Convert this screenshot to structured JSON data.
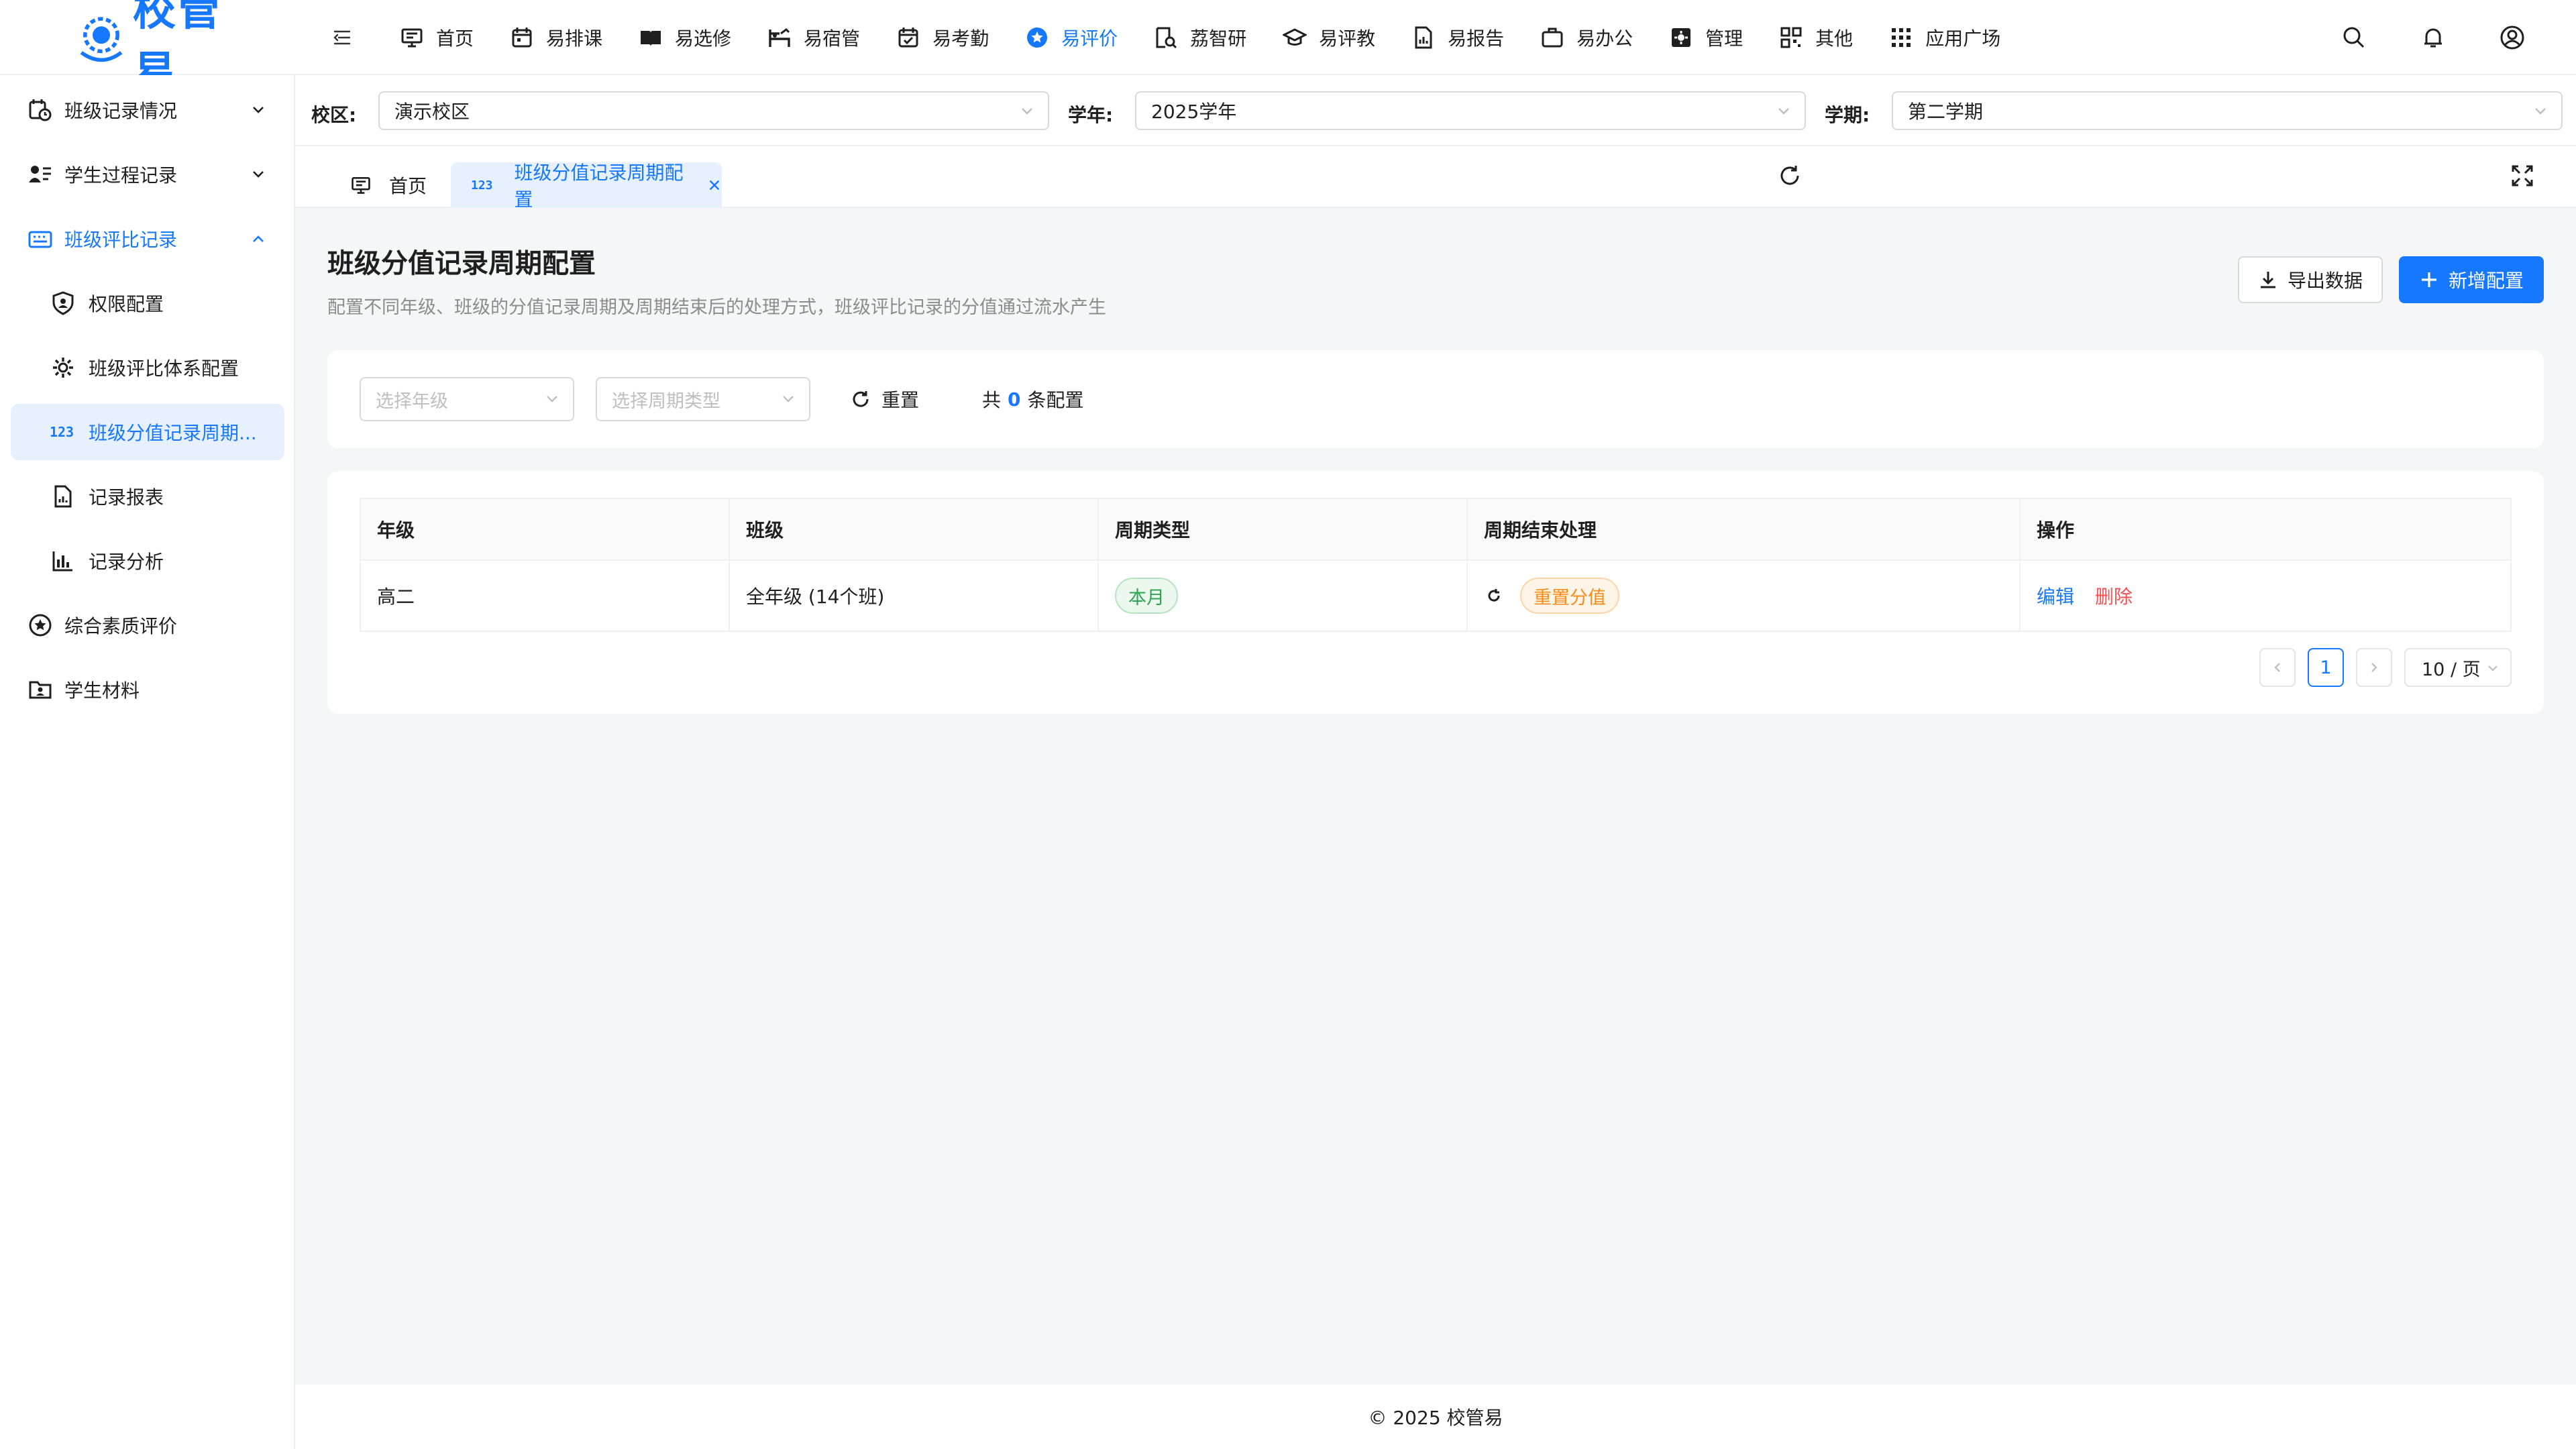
{
  "app": {
    "logo_text": "校管易"
  },
  "nav": [
    {
      "label": "首页",
      "icon": "monitor-icon"
    },
    {
      "label": "易排课",
      "icon": "calendar-icon"
    },
    {
      "label": "易选修",
      "icon": "book-icon"
    },
    {
      "label": "易宿管",
      "icon": "bunk-icon"
    },
    {
      "label": "易考勤",
      "icon": "calendar-check-icon"
    },
    {
      "label": "易评价",
      "icon": "star-circle-icon",
      "active": true
    },
    {
      "label": "荔智研",
      "icon": "research-icon"
    },
    {
      "label": "易评教",
      "icon": "graduation-cap-icon"
    },
    {
      "label": "易报告",
      "icon": "report-icon"
    },
    {
      "label": "易办公",
      "icon": "briefcase-icon"
    },
    {
      "label": "管理",
      "icon": "settings-box-icon"
    },
    {
      "label": "其他",
      "icon": "grid-icon"
    },
    {
      "label": "应用广场",
      "icon": "apps-icon"
    }
  ],
  "sidebar": {
    "items": [
      {
        "label": "班级记录情况",
        "icon": "calendar-clock-icon",
        "level": 1
      },
      {
        "label": "学生过程记录",
        "icon": "user-list-icon",
        "level": 1
      },
      {
        "label": "班级评比记录",
        "icon": "keyboard-icon",
        "level": 1,
        "open": true
      },
      {
        "label": "权限配置",
        "icon": "shield-user-icon",
        "level": 2
      },
      {
        "label": "班级评比体系配置",
        "icon": "gear-icon",
        "level": 2
      },
      {
        "label": "班级分值记录周期...",
        "icon": "123",
        "level": 2,
        "selected": true
      },
      {
        "label": "记录报表",
        "icon": "file-chart-icon",
        "level": 2
      },
      {
        "label": "记录分析",
        "icon": "bar-chart-icon",
        "level": 2
      },
      {
        "label": "综合素质评价",
        "icon": "star-circle-icon",
        "level": 1
      },
      {
        "label": "学生材料",
        "icon": "folder-user-icon",
        "level": 1
      }
    ]
  },
  "filters": {
    "campus_label": "校区:",
    "campus_value": "演示校区",
    "year_label": "学年:",
    "year_value": "2025学年",
    "term_label": "学期:",
    "term_value": "第二学期"
  },
  "tabs": {
    "home": "首页",
    "current": "班级分值记录周期配置",
    "current_icon_text": "123"
  },
  "page": {
    "title": "班级分值记录周期配置",
    "description": "配置不同年级、班级的分值记录周期及周期结束后的处理方式，班级评比记录的分值通过流水产生",
    "export_label": "导出数据",
    "add_label": "新增配置"
  },
  "search": {
    "grade_placeholder": "选择年级",
    "cycle_placeholder": "选择周期类型",
    "reset_label": "重置",
    "count_prefix": "共",
    "count_value": "0",
    "count_suffix": "条配置"
  },
  "table": {
    "columns": [
      "年级",
      "班级",
      "周期类型",
      "周期结束处理",
      "操作"
    ],
    "rows": [
      {
        "grade": "高二",
        "class": "全年级 (14个班)",
        "cycle": "本月",
        "end_action": "重置分值",
        "edit": "编辑",
        "delete": "删除"
      }
    ]
  },
  "pagination": {
    "current": "1",
    "page_size": "10 / 页"
  },
  "footer": {
    "text": "© 2025 校管易"
  },
  "colors": {
    "primary": "#1677ff",
    "danger": "#ff4d4f",
    "success": "#2ea44f",
    "warning": "#fa8c16"
  }
}
